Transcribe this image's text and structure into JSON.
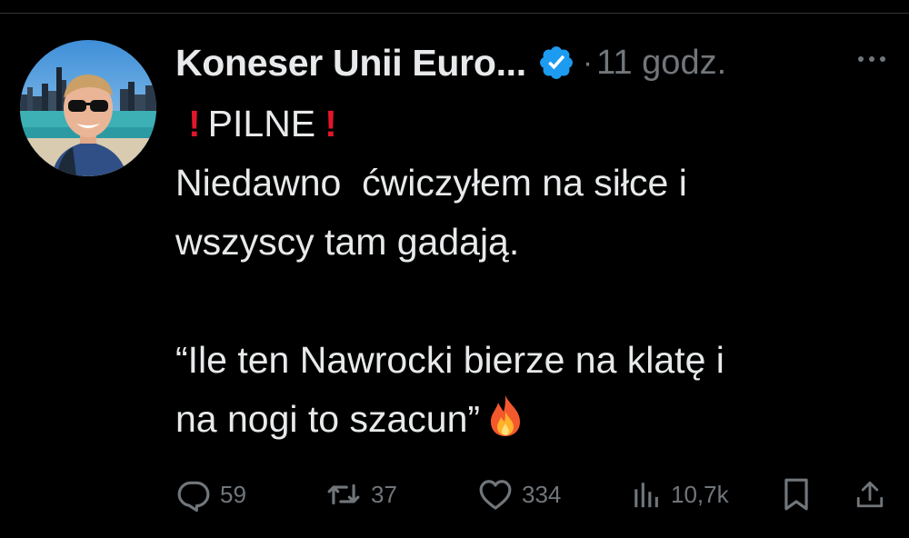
{
  "author": {
    "display_name": "Koneser Unii Euro...",
    "separator": "·",
    "time": "11 godz."
  },
  "tweet": {
    "lines": [
      "PILNE",
      "Niedawno  ćwiczyłem na siłce i",
      "wszyscy tam gadają.",
      "“Ile ten Nawrocki bierze na klatę i",
      "na nogi to szacun”"
    ],
    "emojis": [
      "exclamation-icon",
      "exclamation-icon",
      "fire-icon"
    ]
  },
  "actions": {
    "replies": "59",
    "retweets": "37",
    "likes": "334",
    "views": "10,7k"
  },
  "colors": {
    "background": "#000000",
    "text": "#e7e9ea",
    "muted": "#71767b",
    "verified": "#1d9bf0",
    "exclamation": "#e0172b"
  }
}
